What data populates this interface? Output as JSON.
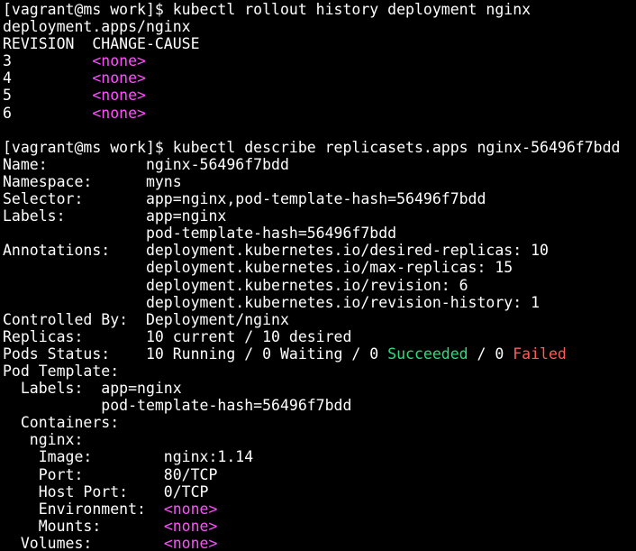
{
  "colors": {
    "background": "#000000",
    "text": "#ffffff",
    "none_highlight": "#ff4fff",
    "succeeded": "#2fdc7b",
    "failed": "#ff5a5a"
  },
  "lines": [
    [
      {
        "t": "[vagrant@ms work]$ kubectl rollout history deployment nginx"
      }
    ],
    [
      {
        "t": "deployment.apps/nginx"
      }
    ],
    [
      {
        "t": "REVISION  CHANGE-CAUSE"
      }
    ],
    [
      {
        "t": "3         "
      },
      {
        "t": "<none>",
        "c": "magenta"
      }
    ],
    [
      {
        "t": "4         "
      },
      {
        "t": "<none>",
        "c": "magenta"
      }
    ],
    [
      {
        "t": "5         "
      },
      {
        "t": "<none>",
        "c": "magenta"
      }
    ],
    [
      {
        "t": "6         "
      },
      {
        "t": "<none>",
        "c": "magenta"
      }
    ],
    [
      {
        "t": ""
      }
    ],
    [
      {
        "t": "[vagrant@ms work]$ kubectl describe replicasets.apps nginx-56496f7bdd"
      }
    ],
    [
      {
        "t": "Name:           nginx-56496f7bdd"
      }
    ],
    [
      {
        "t": "Namespace:      myns"
      }
    ],
    [
      {
        "t": "Selector:       app=nginx,pod-template-hash=56496f7bdd"
      }
    ],
    [
      {
        "t": "Labels:         app=nginx"
      }
    ],
    [
      {
        "t": "                pod-template-hash=56496f7bdd"
      }
    ],
    [
      {
        "t": "Annotations:    deployment.kubernetes.io/desired-replicas: 10"
      }
    ],
    [
      {
        "t": "                deployment.kubernetes.io/max-replicas: 15"
      }
    ],
    [
      {
        "t": "                deployment.kubernetes.io/revision: 6"
      }
    ],
    [
      {
        "t": "                deployment.kubernetes.io/revision-history: 1"
      }
    ],
    [
      {
        "t": "Controlled By:  Deployment/nginx"
      }
    ],
    [
      {
        "t": "Replicas:       10 current / 10 desired"
      }
    ],
    [
      {
        "t": "Pods Status:    10 Running / 0 Waiting / 0 "
      },
      {
        "t": "Succeeded",
        "c": "green"
      },
      {
        "t": " / 0 "
      },
      {
        "t": "Failed",
        "c": "red"
      }
    ],
    [
      {
        "t": "Pod Template:"
      }
    ],
    [
      {
        "t": "  Labels:  app=nginx"
      }
    ],
    [
      {
        "t": "           pod-template-hash=56496f7bdd"
      }
    ],
    [
      {
        "t": "  Containers:"
      }
    ],
    [
      {
        "t": "   nginx:"
      }
    ],
    [
      {
        "t": "    Image:        nginx:1.14"
      }
    ],
    [
      {
        "t": "    Port:         80/TCP"
      }
    ],
    [
      {
        "t": "    Host Port:    0/TCP"
      }
    ],
    [
      {
        "t": "    Environment:  "
      },
      {
        "t": "<none>",
        "c": "magenta"
      }
    ],
    [
      {
        "t": "    Mounts:       "
      },
      {
        "t": "<none>",
        "c": "magenta"
      }
    ],
    [
      {
        "t": "  Volumes:        "
      },
      {
        "t": "<none>",
        "c": "magenta"
      }
    ]
  ]
}
